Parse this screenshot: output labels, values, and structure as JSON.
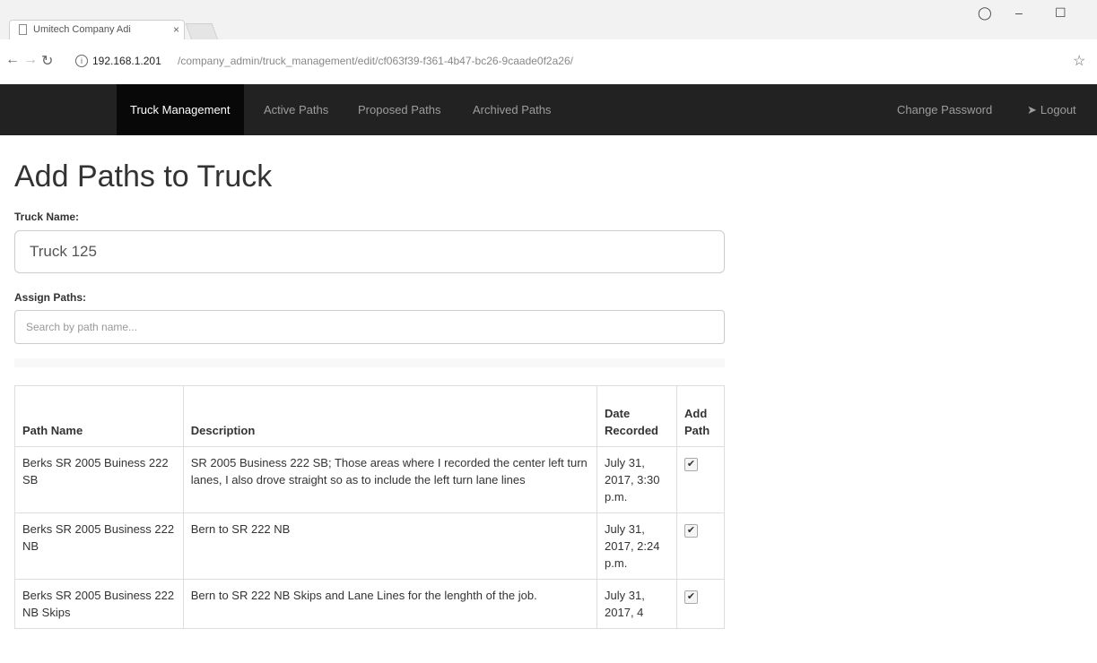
{
  "browser": {
    "tab_title": "Umitech Company Adi",
    "tab_close": "×",
    "url_host": "192.168.1.201",
    "url_path": "/company_admin/truck_management/edit/cf063f39-f361-4b47-bc26-9caade0f2a26/",
    "icons": {
      "back": "back-arrow-icon",
      "forward": "forward-arrow-icon",
      "reload": "reload-icon",
      "info": "info-icon",
      "star": "star-icon",
      "account": "account-icon",
      "minimize": "minimize-icon",
      "maximize": "maximize-icon"
    }
  },
  "navbar": {
    "items": [
      {
        "label": "Truck Management",
        "active": true
      },
      {
        "label": "Active Paths"
      },
      {
        "label": "Proposed Paths"
      },
      {
        "label": "Archived Paths"
      }
    ],
    "right": {
      "change_password": "Change Password",
      "logout": "Logout"
    },
    "colors": {
      "background": "#222222",
      "active": "#080808"
    }
  },
  "page": {
    "title": "Add Paths to Truck",
    "truck_name_label": "Truck Name:",
    "truck_name_value": "Truck 125",
    "assign_paths_label": "Assign Paths:",
    "search_placeholder": "Search by path name..."
  },
  "table": {
    "headers": [
      "Path Name",
      "Description",
      "Date Recorded",
      "Add Path"
    ],
    "rows": [
      {
        "path_name": "Berks SR 2005 Buiness 222 SB",
        "description": "SR 2005 Business 222 SB; Those areas where I recorded the center left turn lanes, I also drove straight so as to include the left turn lane lines",
        "date": "July 31, 2017, 3:30 p.m.",
        "checked": true
      },
      {
        "path_name": "Berks SR 2005 Business 222 NB",
        "description": "Bern to SR 222 NB",
        "date": "July 31, 2017, 2:24 p.m.",
        "checked": true
      },
      {
        "path_name": "Berks SR 2005 Business 222 NB Skips",
        "description": "Bern to SR 222 NB Skips and Lane Lines for the lenghth of the job.",
        "date": "July 31, 2017, 4",
        "checked": true
      }
    ]
  }
}
